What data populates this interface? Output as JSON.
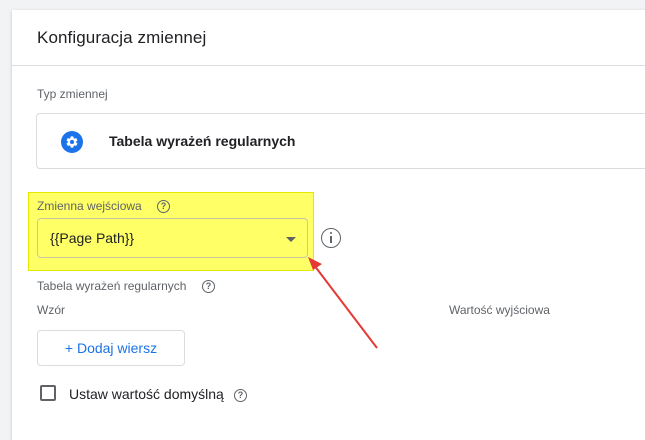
{
  "panel": {
    "title": "Konfiguracja zmiennej"
  },
  "variable_type": {
    "label": "Typ zmiennej",
    "value": "Tabela wyrażeń regularnych",
    "icon": "gear-icon"
  },
  "input_variable": {
    "label": "Zmienna wejściowa",
    "value": "{{Page Path}}",
    "help_glyph": "?"
  },
  "regex_table": {
    "label": "Tabela wyrażeń regularnych",
    "help_glyph": "?",
    "columns": [
      "Wzór",
      "Wartość wyjściowa"
    ],
    "add_row_label": "+ Dodaj wiersz"
  },
  "default_value": {
    "label": "Ustaw wartość domyślną",
    "help_glyph": "?",
    "checked": false
  },
  "colors": {
    "accent": "#1a73e8",
    "highlight": "#ffff66",
    "annotation_arrow": "#e53935"
  }
}
